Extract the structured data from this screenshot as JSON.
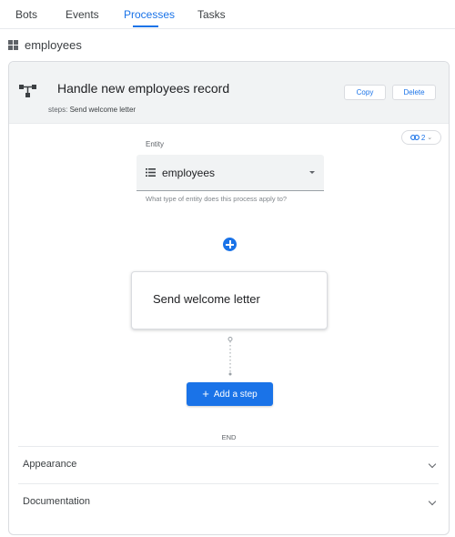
{
  "tabs": [
    {
      "label": "Bots"
    },
    {
      "label": "Events"
    },
    {
      "label": "Processes"
    },
    {
      "label": "Tasks"
    }
  ],
  "active_tab": "Processes",
  "breadcrumb": {
    "label": "employees",
    "icon": "grid-icon"
  },
  "process": {
    "title": "Handle new employees record",
    "steps_prefix": "steps:",
    "steps_value": "Send welcome letter",
    "copy_label": "Copy",
    "delete_label": "Delete",
    "link_count": "2"
  },
  "entity": {
    "label": "Entity",
    "value": "employees",
    "help": "What type of entity does this process apply to?"
  },
  "step": {
    "title": "Send welcome letter"
  },
  "add_step_label": "Add a step",
  "end_label": "END",
  "sections": [
    {
      "label": "Appearance"
    },
    {
      "label": "Documentation"
    }
  ],
  "colors": {
    "accent": "#1a73e8",
    "header_bg": "#f1f3f4",
    "border": "#dadce0"
  }
}
